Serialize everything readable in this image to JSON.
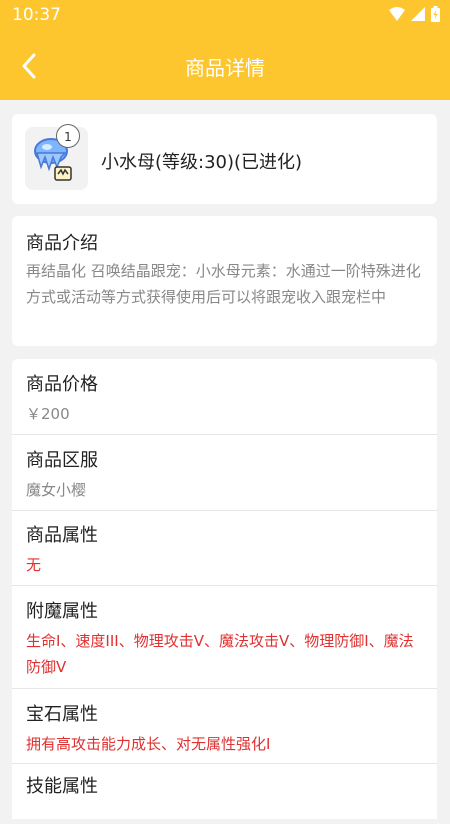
{
  "status_bar": {
    "time": "10:37"
  },
  "header": {
    "title": "商品详情",
    "back_icon": "chevron-left-icon"
  },
  "item": {
    "name": "小水母(等级:30)(已进化)",
    "badge_count": "1"
  },
  "intro": {
    "title": "商品介绍",
    "text": "再结晶化 召唤结晶跟宠：小水母元素：水通过一阶特殊进化方式或活动等方式获得使用后可以将跟宠收入跟宠栏中"
  },
  "attributes": [
    {
      "label": "商品价格",
      "value": "￥200",
      "style": "gray"
    },
    {
      "label": "商品区服",
      "value": "魔女小樱",
      "style": "gray"
    },
    {
      "label": "商品属性",
      "value": "无",
      "style": "red"
    },
    {
      "label": "附魔属性",
      "value": "生命I、速度III、物理攻击V、魔法攻击V、物理防御I、魔法防御V",
      "style": "red"
    },
    {
      "label": "宝石属性",
      "value": "拥有高攻击能力成长、对无属性强化I",
      "style": "red"
    },
    {
      "label": "技能属性",
      "value": "",
      "style": "red"
    }
  ],
  "colors": {
    "accent": "#fdc52e",
    "red": "#e03131",
    "gray": "#888888"
  }
}
